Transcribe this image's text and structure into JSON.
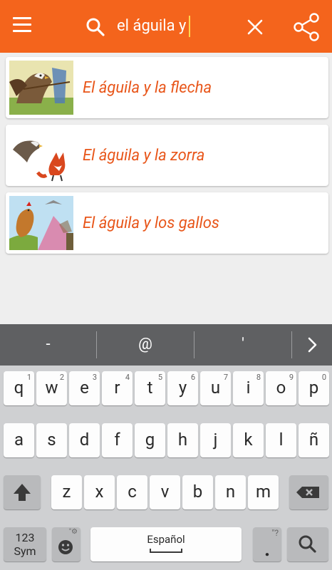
{
  "search": {
    "query": "el águila y"
  },
  "results": [
    {
      "title": "El águila y la flecha"
    },
    {
      "title": "El águila y la zorra"
    },
    {
      "title": "El águila y los gallos"
    }
  ],
  "suggestions": [
    "-",
    "@",
    "'"
  ],
  "keyboard": {
    "row1": [
      {
        "ch": "q",
        "num": "1"
      },
      {
        "ch": "w",
        "num": "2"
      },
      {
        "ch": "e",
        "num": "3"
      },
      {
        "ch": "r",
        "num": "4"
      },
      {
        "ch": "t",
        "num": "5"
      },
      {
        "ch": "y",
        "num": "6"
      },
      {
        "ch": "u",
        "num": "7"
      },
      {
        "ch": "i",
        "num": "8"
      },
      {
        "ch": "o",
        "num": "9"
      },
      {
        "ch": "p",
        "num": "0"
      }
    ],
    "row2": [
      "a",
      "s",
      "d",
      "f",
      "g",
      "h",
      "j",
      "k",
      "l",
      "ñ"
    ],
    "row3": [
      "z",
      "x",
      "c",
      "v",
      "b",
      "n",
      "m"
    ],
    "sym_label_1": "123",
    "sym_label_2": "Sym",
    "space_label": "Español",
    "period": ".",
    "period_extra": "\"?",
    "emoji_extra": "\"⚙"
  },
  "colors": {
    "accent": "#f4641c",
    "title_text": "#e8561a",
    "suggest_bar": "#5f6062",
    "keyboard_bg": "#cfd0d2"
  },
  "icons": [
    "menu-icon",
    "search-icon",
    "close-icon",
    "share-icon",
    "chevron-right-icon",
    "shift-icon",
    "backspace-icon",
    "emoji-icon",
    "search-key-icon"
  ]
}
